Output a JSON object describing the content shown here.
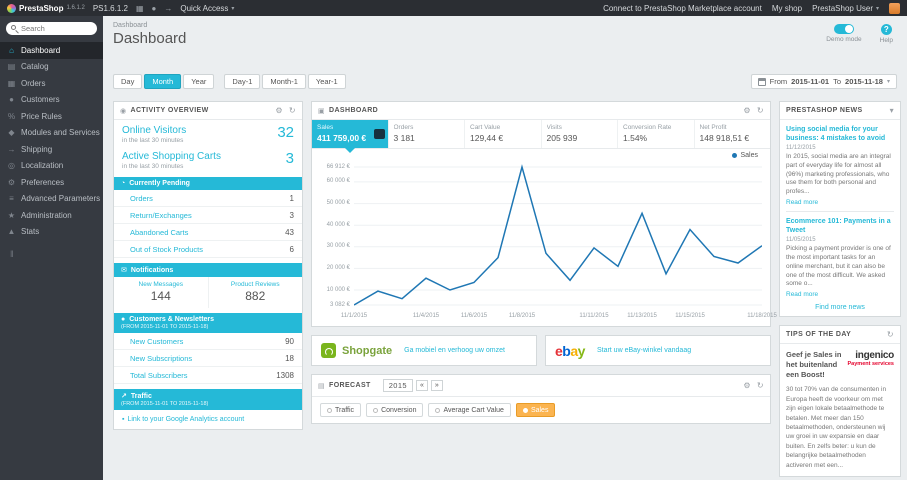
{
  "header": {
    "logo_text": "PrestaShop",
    "logo_version": "1.6.1.2",
    "shop_name": "PS1.6.1.2",
    "icon_cart": "▦",
    "icon_customers": "●",
    "icon_delivery": "→",
    "quick_access": "Quick Access",
    "marketplace_link": "Connect to PrestaShop Marketplace account",
    "my_shop": "My shop",
    "user_name": "PrestaShop User"
  },
  "sidebar": {
    "search_placeholder": "Search",
    "items": [
      {
        "label": "Dashboard",
        "icon": "⌂"
      },
      {
        "label": "Catalog",
        "icon": "▤"
      },
      {
        "label": "Orders",
        "icon": "▦"
      },
      {
        "label": "Customers",
        "icon": "●"
      },
      {
        "label": "Price Rules",
        "icon": "%"
      },
      {
        "label": "Modules and Services",
        "icon": "◆"
      },
      {
        "label": "Shipping",
        "icon": "→"
      },
      {
        "label": "Localization",
        "icon": "◎"
      },
      {
        "label": "Preferences",
        "icon": "⚙"
      },
      {
        "label": "Advanced Parameters",
        "icon": "≡"
      },
      {
        "label": "Administration",
        "icon": "★"
      },
      {
        "label": "Stats",
        "icon": "▲"
      }
    ]
  },
  "page": {
    "breadcrumb": "Dashboard",
    "title": "Dashboard",
    "demo_mode_label": "Demo mode",
    "help_label": "Help"
  },
  "filters": {
    "buttons": [
      "Day",
      "Month",
      "Year",
      "Day-1",
      "Month-1",
      "Year-1"
    ],
    "active": "Month",
    "date_range": {
      "from_label": "From",
      "from": "2015-11-01",
      "to_label": "To",
      "to": "2015-11-18"
    }
  },
  "activity": {
    "title": "ACTIVITY OVERVIEW",
    "online_visitors": {
      "label": "Online Visitors",
      "value": "32",
      "sub": "in the last 30 minutes"
    },
    "active_carts": {
      "label": "Active Shopping Carts",
      "value": "3",
      "sub": "in the last 30 minutes"
    },
    "pending": {
      "title": "Currently Pending",
      "rows": [
        {
          "label": "Orders",
          "value": "1"
        },
        {
          "label": "Return/Exchanges",
          "value": "3"
        },
        {
          "label": "Abandoned Carts",
          "value": "43"
        },
        {
          "label": "Out of Stock Products",
          "value": "6"
        }
      ]
    },
    "notifications": {
      "title": "Notifications",
      "cells": [
        {
          "label": "New Messages",
          "value": "144"
        },
        {
          "label": "Product Reviews",
          "value": "882"
        }
      ]
    },
    "customers": {
      "title": "Customers & Newsletters",
      "subtitle": "(FROM 2015-11-01 TO 2015-11-18)",
      "rows": [
        {
          "label": "New Customers",
          "value": "90"
        },
        {
          "label": "New Subscriptions",
          "value": "18"
        },
        {
          "label": "Total Subscribers",
          "value": "1308"
        }
      ]
    },
    "traffic": {
      "title": "Traffic",
      "subtitle": "(FROM 2015-11-01 TO 2015-11-18)",
      "link": "Link to your Google Analytics account"
    }
  },
  "dashboard_panel": {
    "title": "DASHBOARD",
    "metrics": [
      {
        "label": "Sales",
        "value": "411 759,00 €",
        "active": true
      },
      {
        "label": "Orders",
        "value": "3 181"
      },
      {
        "label": "Cart Value",
        "value": "129,44 €"
      },
      {
        "label": "Visits",
        "value": "205 939"
      },
      {
        "label": "Conversion Rate",
        "value": "1.54%"
      },
      {
        "label": "Net Profit",
        "value": "148 918,51 €"
      }
    ]
  },
  "chart_data": {
    "type": "line",
    "title": "Sales",
    "legend": [
      "Sales"
    ],
    "legend_position": "top-right",
    "grid": true,
    "ylim": [
      3082,
      66912
    ],
    "x": [
      "11/1/2015",
      "11/2/2015",
      "11/3/2015",
      "11/4/2015",
      "11/5/2015",
      "11/6/2015",
      "11/7/2015",
      "11/8/2015",
      "11/9/2015",
      "11/10/2015",
      "11/11/2015",
      "11/12/2015",
      "11/13/2015",
      "11/14/2015",
      "11/15/2015",
      "11/16/2015",
      "11/17/2015",
      "11/18/2015"
    ],
    "series": [
      {
        "name": "Sales",
        "color": "#1f77b4",
        "values": [
          3082,
          9500,
          6000,
          15500,
          10000,
          13500,
          25000,
          66912,
          27000,
          14500,
          29500,
          21000,
          45500,
          17500,
          38000,
          25500,
          22500,
          30500
        ]
      }
    ],
    "x_tick_indices": [
      0,
      3,
      5,
      7,
      10,
      12,
      14,
      17
    ],
    "x_tick_labels": [
      "11/1/2015",
      "11/4/2015",
      "11/6/2015",
      "11/8/2015",
      "11/11/2015",
      "11/13/2015",
      "11/15/2015",
      "11/18/2015"
    ],
    "y_ticks": [
      {
        "label": "66 912 €",
        "value": 66912
      },
      {
        "label": "60 000 €",
        "value": 60000
      },
      {
        "label": "50 000 €",
        "value": 50000
      },
      {
        "label": "40 000 €",
        "value": 40000
      },
      {
        "label": "30 000 €",
        "value": 30000
      },
      {
        "label": "20 000 €",
        "value": 20000
      },
      {
        "label": "10 000 €",
        "value": 10000
      },
      {
        "label": "3 082 €",
        "value": 3082
      }
    ]
  },
  "promos": {
    "shopgate": {
      "name": "Shopgate",
      "link": "Ga mobiel en verhoog uw omzet"
    },
    "ebay": {
      "name": "ebay",
      "colors": [
        "#e53238",
        "#0064d2",
        "#f5af02",
        "#86b817"
      ],
      "link": "Start uw eBay-winkel vandaag"
    }
  },
  "forecast": {
    "title": "FORECAST",
    "year": "2015",
    "legend": [
      {
        "label": "Traffic",
        "color": "#ffffff",
        "active": false
      },
      {
        "label": "Conversion",
        "color": "#ffffff",
        "active": false
      },
      {
        "label": "Average Cart Value",
        "color": "#ffffff",
        "active": false
      },
      {
        "label": "Sales",
        "color": "#fbb450",
        "active": true
      }
    ]
  },
  "news": {
    "title": "PRESTASHOP NEWS",
    "articles": [
      {
        "title": "Using social media for your business: 4 mistakes to avoid",
        "date": "11/12/2015",
        "excerpt": "In 2015, social media are an integral part of everyday life for almost all (96%) marketing professionals, who use them for both personal and profes...",
        "link": "Read more"
      },
      {
        "title": "Ecommerce 101: Payments in a Tweet",
        "date": "11/05/2015",
        "excerpt": "Picking a payment provider is one of the most important tasks for an online merchant, but it can also be one of the most difficult. We asked some o...",
        "link": "Read more"
      }
    ],
    "more_link": "Find more news"
  },
  "tips": {
    "title": "TIPS OF THE DAY",
    "heading": "Geef je Sales in het buitenland een Boost!",
    "brand": {
      "name": "ingenico",
      "tagline": "Payment services"
    },
    "body": "30 tot 70% van de consumenten in Europa heeft de voorkeur om met zijn eigen lokale betaalmethode te betalen. Met meer dan 150 betaalmethoden, ondersteunen wij uw groei in uw expansie en daar buiten. En zelfs beter: u kun de belangrijke betaalmethoden activeren met een..."
  },
  "colors": {
    "accent": "#25b9d7",
    "sidebar": "#363a41",
    "sales_line": "#1f77b4",
    "forecast_sales": "#fbb450"
  }
}
